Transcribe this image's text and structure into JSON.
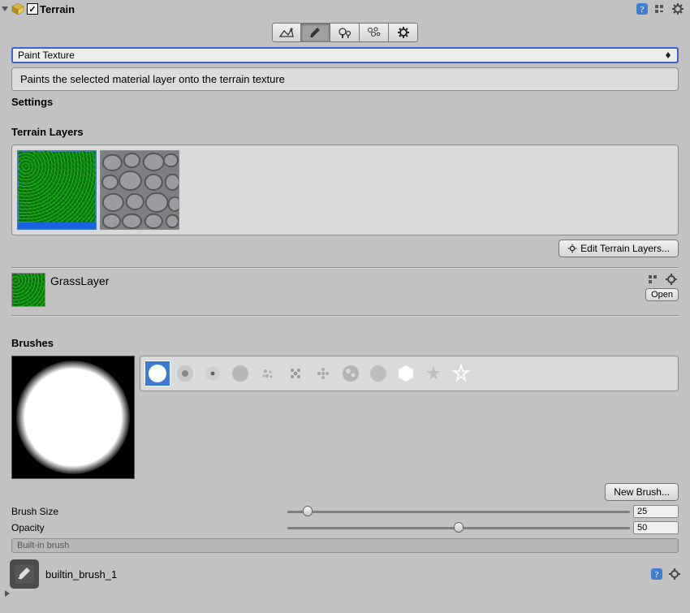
{
  "header": {
    "title": "Terrain",
    "checked": true
  },
  "toolbar": {
    "active_index": 1
  },
  "dropdown_value": "Paint Texture",
  "helpbox_text": "Paints the selected material layer onto the terrain texture",
  "settings_label": "Settings",
  "layers": {
    "title": "Terrain Layers",
    "items": [
      "grass",
      "stone"
    ],
    "selected_index": 0,
    "edit_button": "Edit Terrain Layers..."
  },
  "layer_detail": {
    "name": "GrassLayer",
    "open_button": "Open"
  },
  "brushes": {
    "title": "Brushes",
    "selected_index": 0,
    "new_button": "New Brush...",
    "size_label": "Brush Size",
    "size_value": "25",
    "size_pct": 6,
    "opacity_label": "Opacity",
    "opacity_value": "50",
    "opacity_pct": 50,
    "status_text": "Built-in brush"
  },
  "asset": {
    "name": "builtin_brush_1"
  }
}
